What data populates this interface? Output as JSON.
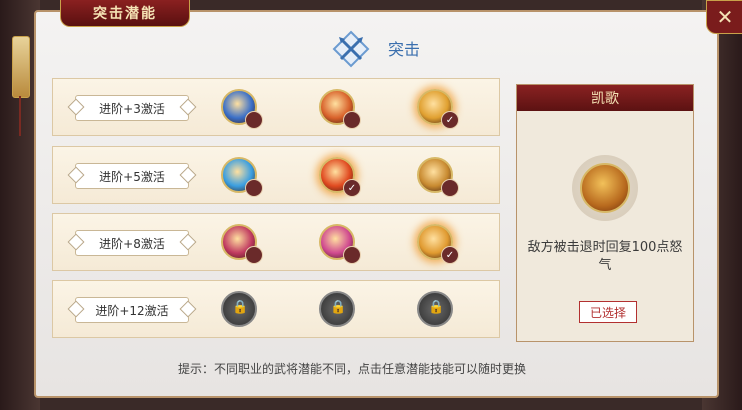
{
  "title_tab": "突击潜能",
  "close_label": "✕",
  "header": {
    "title": "突击",
    "icon": "crossed-spears-icon"
  },
  "rows": [
    {
      "label": "进阶+3激活",
      "skills": [
        {
          "icon": "shield-skill-icon",
          "color": "#3a6fc8",
          "state": "unselected"
        },
        {
          "icon": "spear-fire-skill-icon",
          "color": "#d8612a",
          "state": "unselected"
        },
        {
          "icon": "golden-warrior-skill-icon",
          "color": "#e0a030",
          "state": "selected"
        }
      ]
    },
    {
      "label": "进阶+5激活",
      "skills": [
        {
          "icon": "ice-slash-skill-icon",
          "color": "#3a9ee0",
          "state": "unselected"
        },
        {
          "icon": "fire-burst-skill-icon",
          "color": "#e04a20",
          "state": "selected"
        },
        {
          "icon": "general-skill-icon",
          "color": "#c88a30",
          "state": "unselected"
        }
      ]
    },
    {
      "label": "进阶+8激活",
      "skills": [
        {
          "icon": "crimson-warrior-skill-icon",
          "color": "#c03a60",
          "state": "unselected"
        },
        {
          "icon": "pink-slash-skill-icon",
          "color": "#d04a90",
          "state": "unselected"
        },
        {
          "icon": "golden-general-skill-icon",
          "color": "#e09a30",
          "state": "selected"
        }
      ]
    },
    {
      "label": "进阶+12激活",
      "skills": [
        {
          "icon": "lock-icon",
          "color": "#555555",
          "state": "locked"
        },
        {
          "icon": "lock-icon",
          "color": "#777777",
          "state": "locked"
        },
        {
          "icon": "lock-icon",
          "color": "#555555",
          "state": "locked"
        }
      ]
    }
  ],
  "detail": {
    "name": "凯歌",
    "description": "敌方被击退时回复100点怒气",
    "button": "已选择"
  },
  "tip": "提示：不同职业的武将潜能不同，点击任意潜能技能可以随时更换",
  "badge_check": "✓",
  "lock_glyph": "🔒"
}
